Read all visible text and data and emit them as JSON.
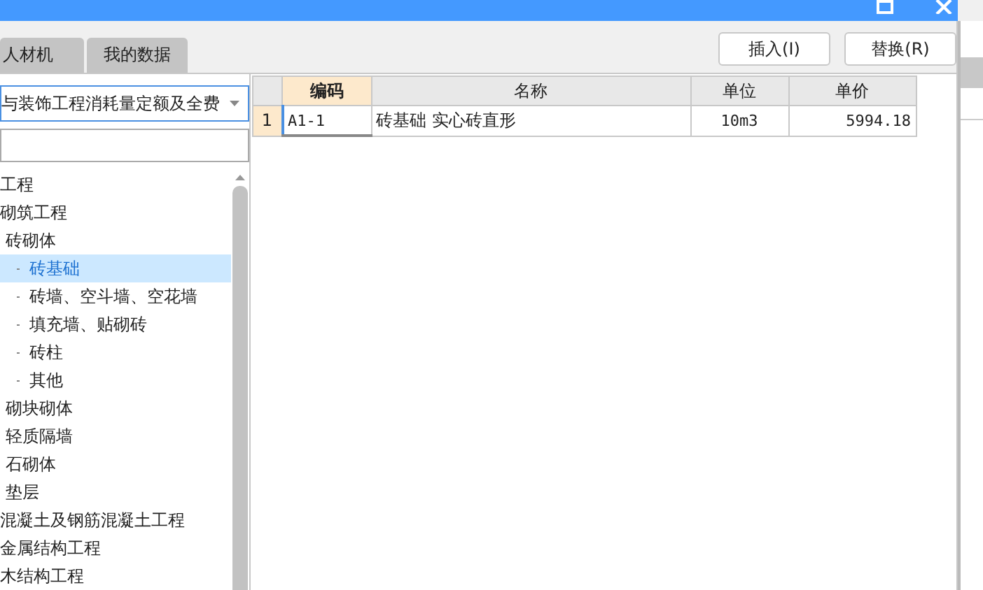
{
  "window": {
    "controls": [
      {
        "kind": "maximize"
      },
      {
        "kind": "close"
      }
    ]
  },
  "tabs": [
    {
      "label": "人材机",
      "selected": false
    },
    {
      "label": "我的数据",
      "selected": false
    }
  ],
  "buttons": [
    "插入(I)",
    "替换(R)"
  ],
  "library_select": {
    "value": "与装饰工程消耗量定额及全费"
  },
  "tree": [
    {
      "label": "工程",
      "selected": false
    },
    {
      "label": "砌筑工程",
      "selected": false,
      "children": [
        {
          "label": "砖砌体",
          "selected": false,
          "children": [
            {
              "label": "砖基础",
              "selected": true
            },
            {
              "label": "砖墙、空斗墙、空花墙",
              "selected": false
            },
            {
              "label": "填充墙、贴砌砖",
              "selected": false
            },
            {
              "label": "砖柱",
              "selected": false
            },
            {
              "label": "其他",
              "selected": false
            }
          ]
        },
        {
          "label": "砌块砌体",
          "selected": false
        },
        {
          "label": "轻质隔墙",
          "selected": false
        },
        {
          "label": "石砌体",
          "selected": false
        },
        {
          "label": "垫层",
          "selected": false
        }
      ]
    },
    {
      "label": "混凝土及钢筋混凝土工程",
      "selected": false
    },
    {
      "label": "金属结构工程",
      "selected": false
    },
    {
      "label": "木结构工程",
      "selected": false
    }
  ],
  "table": {
    "columns": [
      "编码",
      "名称",
      "单位",
      "单价"
    ],
    "rows": [
      {
        "number": "1",
        "cells": [
          "A1-1",
          "砖基础 实心砖直形",
          "10m3",
          "5994.18"
        ],
        "selected": true
      }
    ]
  }
}
